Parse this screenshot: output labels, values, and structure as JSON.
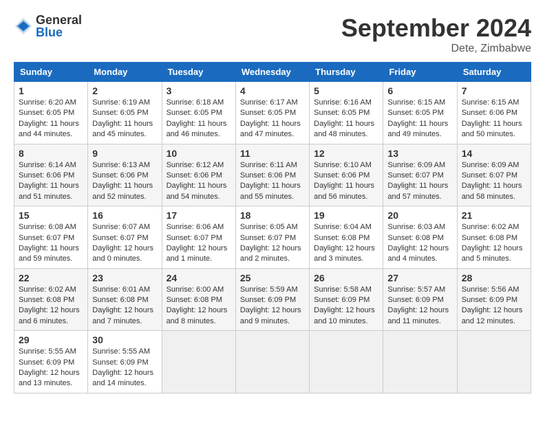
{
  "header": {
    "logo_general": "General",
    "logo_blue": "Blue",
    "month_title": "September 2024",
    "location": "Dete, Zimbabwe"
  },
  "days_of_week": [
    "Sunday",
    "Monday",
    "Tuesday",
    "Wednesday",
    "Thursday",
    "Friday",
    "Saturday"
  ],
  "weeks": [
    [
      {
        "day": "1",
        "sunrise": "6:20 AM",
        "sunset": "6:05 PM",
        "daylight": "11 hours and 44 minutes."
      },
      {
        "day": "2",
        "sunrise": "6:19 AM",
        "sunset": "6:05 PM",
        "daylight": "11 hours and 45 minutes."
      },
      {
        "day": "3",
        "sunrise": "6:18 AM",
        "sunset": "6:05 PM",
        "daylight": "11 hours and 46 minutes."
      },
      {
        "day": "4",
        "sunrise": "6:17 AM",
        "sunset": "6:05 PM",
        "daylight": "11 hours and 47 minutes."
      },
      {
        "day": "5",
        "sunrise": "6:16 AM",
        "sunset": "6:05 PM",
        "daylight": "11 hours and 48 minutes."
      },
      {
        "day": "6",
        "sunrise": "6:15 AM",
        "sunset": "6:05 PM",
        "daylight": "11 hours and 49 minutes."
      },
      {
        "day": "7",
        "sunrise": "6:15 AM",
        "sunset": "6:06 PM",
        "daylight": "11 hours and 50 minutes."
      }
    ],
    [
      {
        "day": "8",
        "sunrise": "6:14 AM",
        "sunset": "6:06 PM",
        "daylight": "11 hours and 51 minutes."
      },
      {
        "day": "9",
        "sunrise": "6:13 AM",
        "sunset": "6:06 PM",
        "daylight": "11 hours and 52 minutes."
      },
      {
        "day": "10",
        "sunrise": "6:12 AM",
        "sunset": "6:06 PM",
        "daylight": "11 hours and 54 minutes."
      },
      {
        "day": "11",
        "sunrise": "6:11 AM",
        "sunset": "6:06 PM",
        "daylight": "11 hours and 55 minutes."
      },
      {
        "day": "12",
        "sunrise": "6:10 AM",
        "sunset": "6:06 PM",
        "daylight": "11 hours and 56 minutes."
      },
      {
        "day": "13",
        "sunrise": "6:09 AM",
        "sunset": "6:07 PM",
        "daylight": "11 hours and 57 minutes."
      },
      {
        "day": "14",
        "sunrise": "6:09 AM",
        "sunset": "6:07 PM",
        "daylight": "11 hours and 58 minutes."
      }
    ],
    [
      {
        "day": "15",
        "sunrise": "6:08 AM",
        "sunset": "6:07 PM",
        "daylight": "11 hours and 59 minutes."
      },
      {
        "day": "16",
        "sunrise": "6:07 AM",
        "sunset": "6:07 PM",
        "daylight": "12 hours and 0 minutes."
      },
      {
        "day": "17",
        "sunrise": "6:06 AM",
        "sunset": "6:07 PM",
        "daylight": "12 hours and 1 minute."
      },
      {
        "day": "18",
        "sunrise": "6:05 AM",
        "sunset": "6:07 PM",
        "daylight": "12 hours and 2 minutes."
      },
      {
        "day": "19",
        "sunrise": "6:04 AM",
        "sunset": "6:08 PM",
        "daylight": "12 hours and 3 minutes."
      },
      {
        "day": "20",
        "sunrise": "6:03 AM",
        "sunset": "6:08 PM",
        "daylight": "12 hours and 4 minutes."
      },
      {
        "day": "21",
        "sunrise": "6:02 AM",
        "sunset": "6:08 PM",
        "daylight": "12 hours and 5 minutes."
      }
    ],
    [
      {
        "day": "22",
        "sunrise": "6:02 AM",
        "sunset": "6:08 PM",
        "daylight": "12 hours and 6 minutes."
      },
      {
        "day": "23",
        "sunrise": "6:01 AM",
        "sunset": "6:08 PM",
        "daylight": "12 hours and 7 minutes."
      },
      {
        "day": "24",
        "sunrise": "6:00 AM",
        "sunset": "6:08 PM",
        "daylight": "12 hours and 8 minutes."
      },
      {
        "day": "25",
        "sunrise": "5:59 AM",
        "sunset": "6:09 PM",
        "daylight": "12 hours and 9 minutes."
      },
      {
        "day": "26",
        "sunrise": "5:58 AM",
        "sunset": "6:09 PM",
        "daylight": "12 hours and 10 minutes."
      },
      {
        "day": "27",
        "sunrise": "5:57 AM",
        "sunset": "6:09 PM",
        "daylight": "12 hours and 11 minutes."
      },
      {
        "day": "28",
        "sunrise": "5:56 AM",
        "sunset": "6:09 PM",
        "daylight": "12 hours and 12 minutes."
      }
    ],
    [
      {
        "day": "29",
        "sunrise": "5:55 AM",
        "sunset": "6:09 PM",
        "daylight": "12 hours and 13 minutes."
      },
      {
        "day": "30",
        "sunrise": "5:55 AM",
        "sunset": "6:09 PM",
        "daylight": "12 hours and 14 minutes."
      },
      null,
      null,
      null,
      null,
      null
    ]
  ],
  "labels": {
    "sunrise": "Sunrise:",
    "sunset": "Sunset:",
    "daylight": "Daylight:"
  }
}
